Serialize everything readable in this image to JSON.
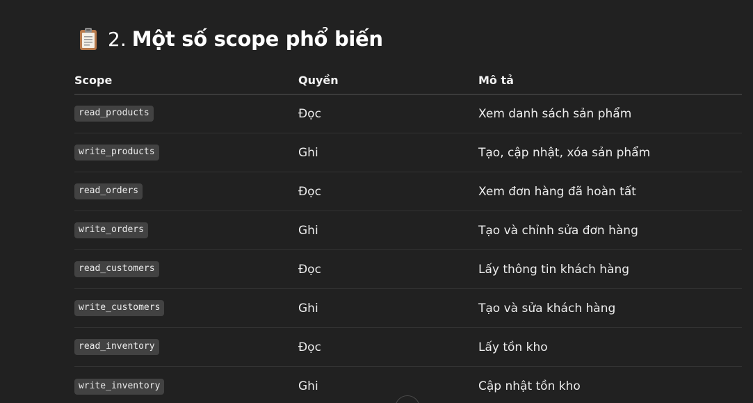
{
  "section": {
    "icon": "clipboard-icon",
    "number": "2.",
    "title": "Một số scope phổ biến"
  },
  "table": {
    "headers": [
      "Scope",
      "Quyền",
      "Mô tả"
    ],
    "rows": [
      {
        "scope": "read_products",
        "permission": "Đọc",
        "description": "Xem danh sách sản phẩm"
      },
      {
        "scope": "write_products",
        "permission": "Ghi",
        "description": "Tạo, cập nhật, xóa sản phẩm"
      },
      {
        "scope": "read_orders",
        "permission": "Đọc",
        "description": "Xem đơn hàng đã hoàn tất"
      },
      {
        "scope": "write_orders",
        "permission": "Ghi",
        "description": "Tạo và chỉnh sửa đơn hàng"
      },
      {
        "scope": "read_customers",
        "permission": "Đọc",
        "description": "Lấy thông tin khách hàng"
      },
      {
        "scope": "write_customers",
        "permission": "Ghi",
        "description": "Tạo và sửa khách hàng"
      },
      {
        "scope": "read_inventory",
        "permission": "Đọc",
        "description": "Lấy tồn kho"
      },
      {
        "scope": "write_inventory",
        "permission": "Ghi",
        "description": "Cập nhật tồn kho"
      }
    ]
  },
  "scroll_button": {
    "icon": "scroll-down-icon"
  },
  "colors": {
    "background": "#212121",
    "text": "#ececec",
    "code_background": "#424242",
    "divider": "#333333"
  }
}
